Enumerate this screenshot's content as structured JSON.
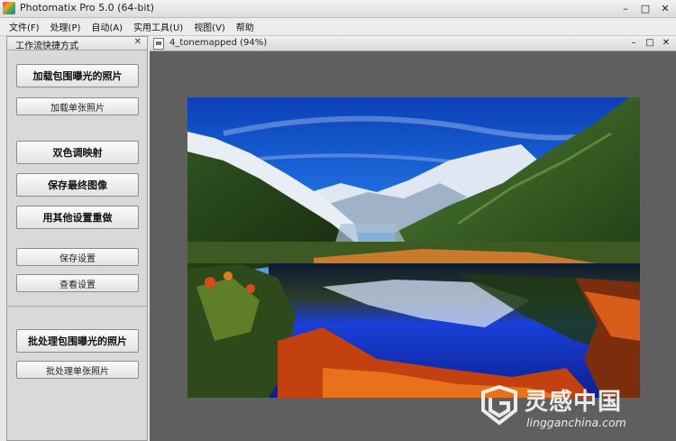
{
  "window": {
    "title": "Photomatix Pro 5.0 (64-bit)",
    "minimize": "–",
    "maximize": "□",
    "close": "✕"
  },
  "menu": [
    {
      "label": "文件(F)"
    },
    {
      "label": "处理(P)"
    },
    {
      "label": "自动(A)"
    },
    {
      "label": "实用工具(U)"
    },
    {
      "label": "视图(V)"
    },
    {
      "label": "帮助"
    }
  ],
  "panel": {
    "title": "工作流快捷方式",
    "close": "✕",
    "buttons": [
      {
        "label": "加载包围曝光的照片"
      },
      {
        "label": "加载单张照片"
      },
      {
        "label": "双色调映射"
      },
      {
        "label": "保存最终图像"
      },
      {
        "label": "用其他设置重做"
      },
      {
        "label": "保存设置"
      },
      {
        "label": "查看设置"
      },
      {
        "label": "批处理包围曝光的照片"
      },
      {
        "label": "批处理单张照片"
      }
    ]
  },
  "document": {
    "title": "4_tonemapped (94%)",
    "minimize": "–",
    "maximize": "□",
    "close": "✕"
  },
  "watermark": {
    "cn": "灵感中国",
    "en": "lingganchina.com"
  },
  "colors": {
    "sky": "#1f6fe0",
    "lake": "#1a3fd8",
    "foliage_orange": "#e0641c",
    "mountain_green": "#3f6b2a"
  }
}
